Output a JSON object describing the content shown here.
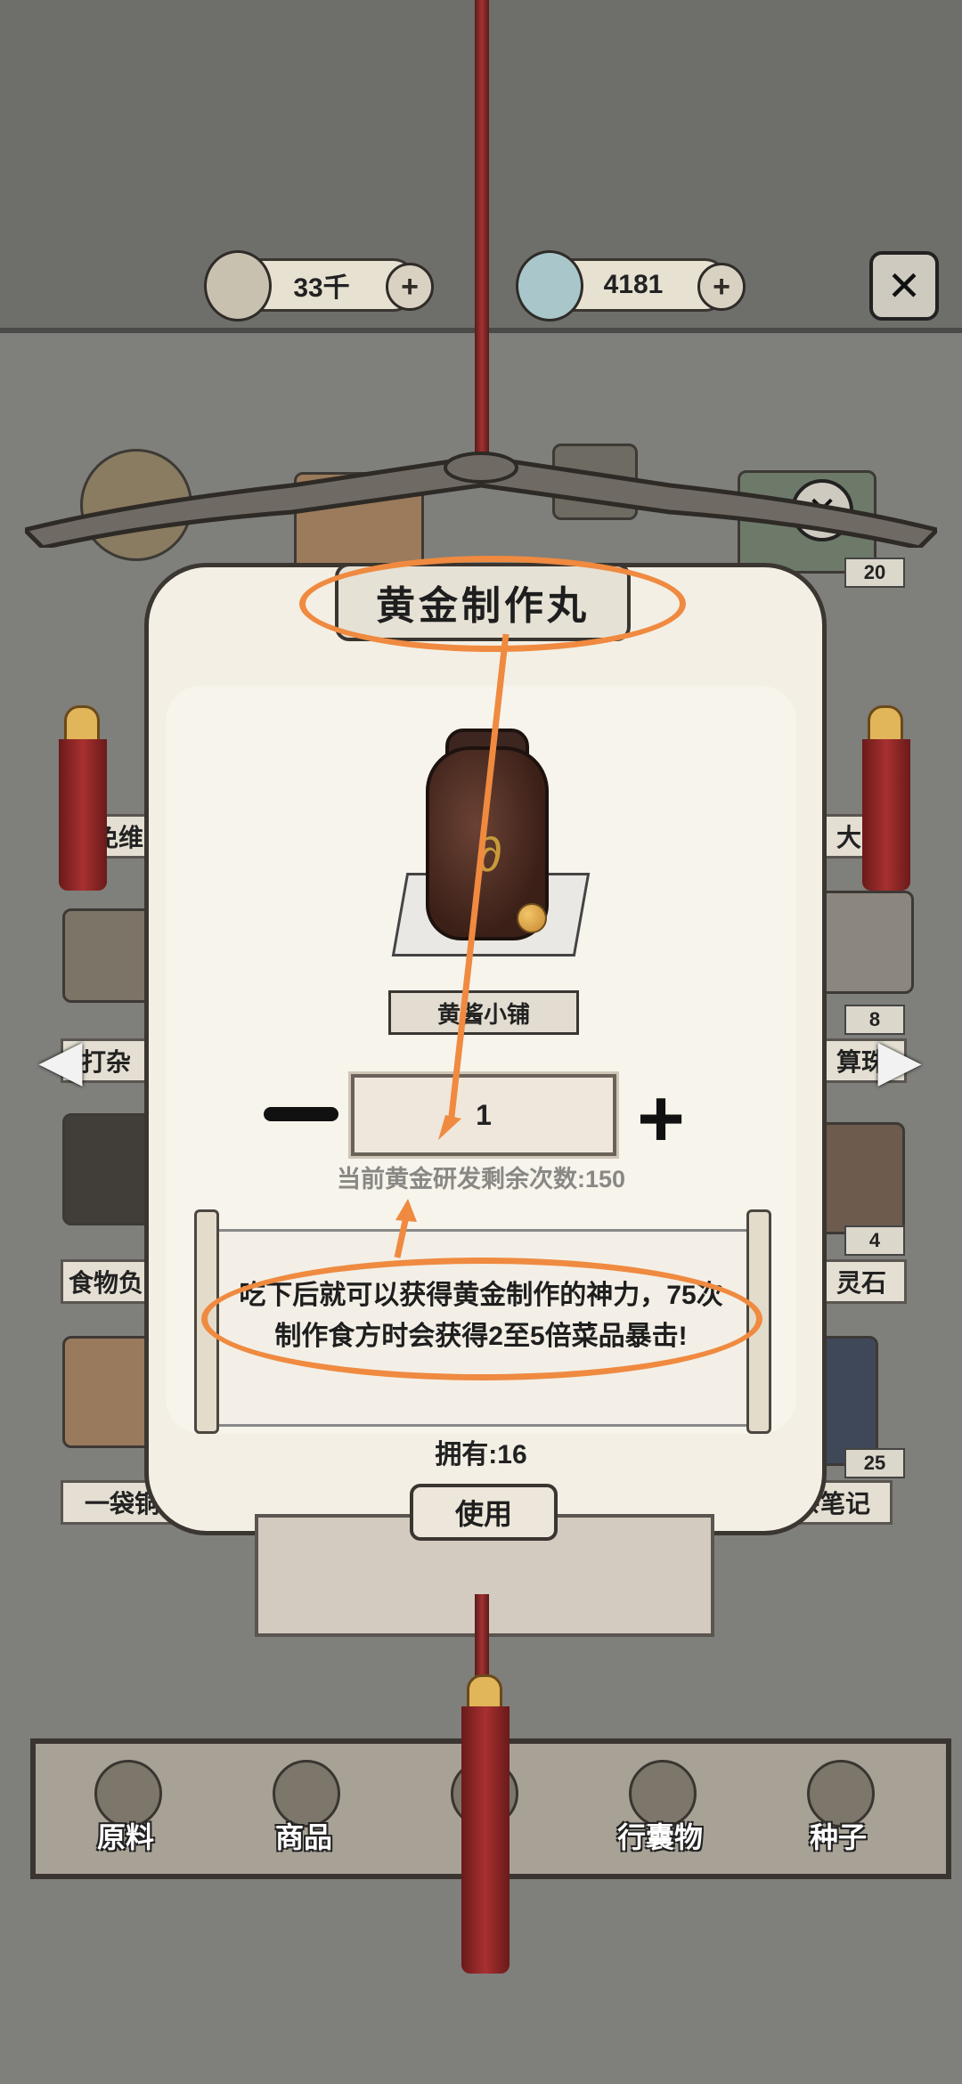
{
  "resources": [
    {
      "icon": "copper-coin-icon",
      "value": "33千"
    },
    {
      "icon": "jade-stone-icon",
      "value": "4181"
    }
  ],
  "modal": {
    "title": "黄金制作丸",
    "shop_tag": "黄酱小铺",
    "quantity": "1",
    "remaining": "当前黄金研发剩余次数:150",
    "description_line1": "吃下后就可以获得黄金制作的神力，75次",
    "description_line2": "制作食方时会获得2至5倍菜品暴击!",
    "owned": "拥有:16",
    "use_label": "使用"
  },
  "background_labels": {
    "left": [
      "御免维",
      "打杂",
      "食物负",
      "一袋铜币"
    ],
    "right": [
      "大吉",
      "算珠",
      "灵石",
      "行杂笔记"
    ],
    "counts": [
      "8",
      "4",
      "25",
      "20"
    ]
  },
  "bottom_tabs": [
    {
      "label": "原料",
      "icon": "leaf-icon"
    },
    {
      "label": "商品",
      "icon": "tofu-icon"
    },
    {
      "label": "",
      "icon": "cloth-icon"
    },
    {
      "label": "行囊物",
      "icon": "robe-icon"
    },
    {
      "label": "种子",
      "icon": "seed-bag-icon"
    }
  ],
  "colors": {
    "highlight": "#ef8a40",
    "panel": "#f3efe4",
    "cord": "#a33232"
  }
}
